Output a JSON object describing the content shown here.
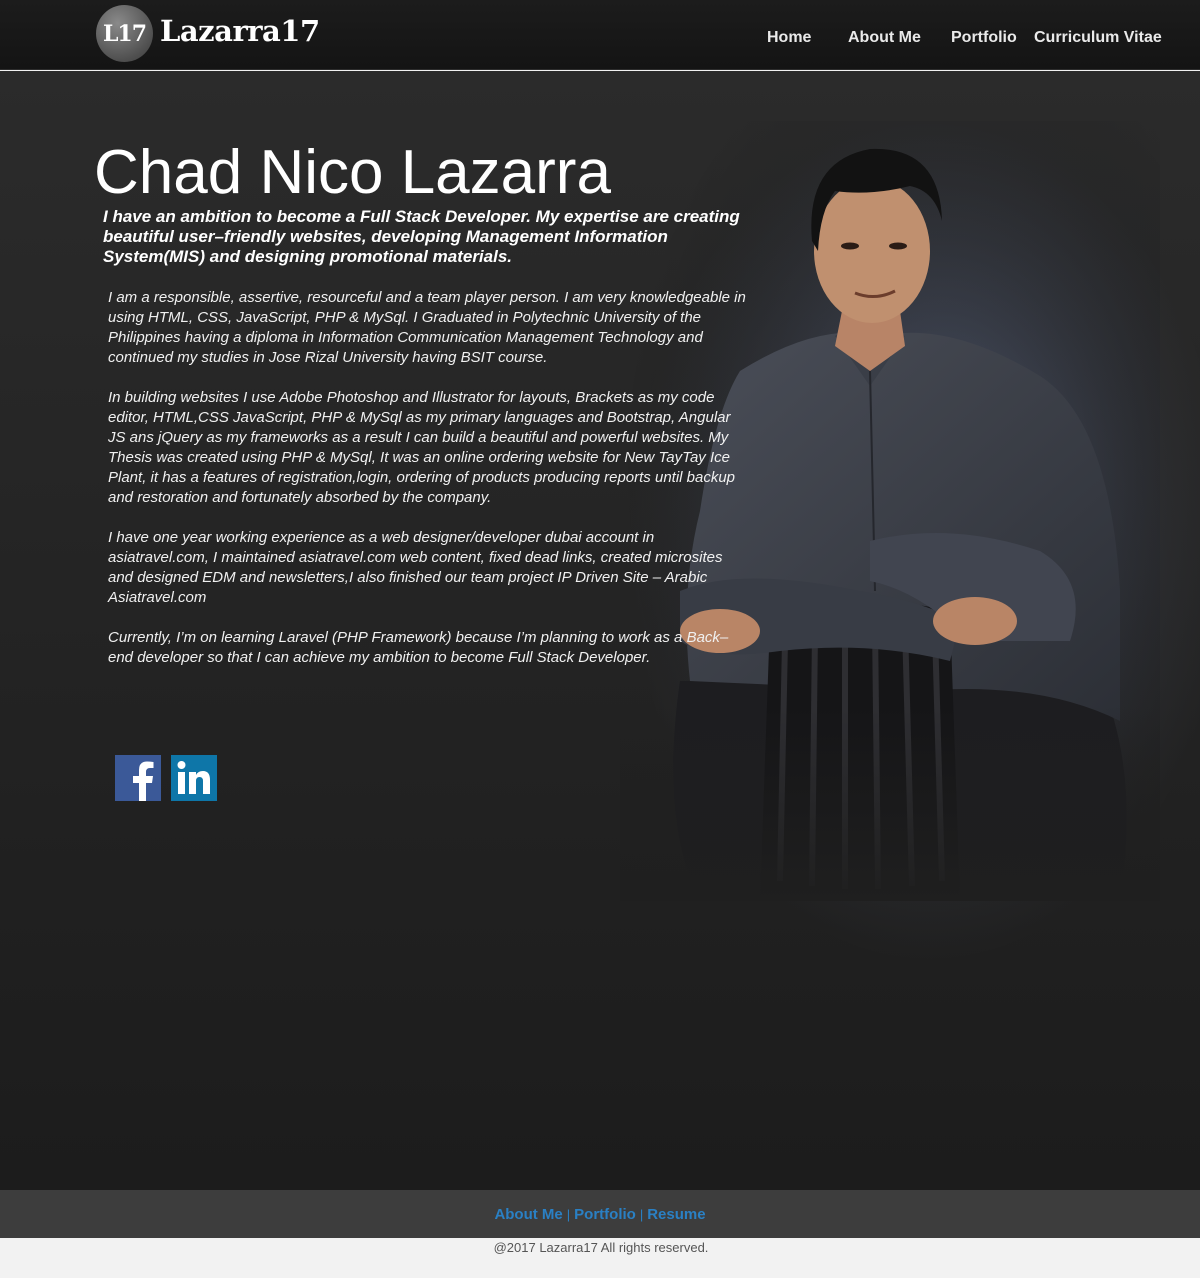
{
  "header": {
    "logo_badge": "L17",
    "logo_text": "Lazarra17",
    "nav": [
      {
        "label": "Home"
      },
      {
        "label": "About Me"
      },
      {
        "label": "Portfolio"
      },
      {
        "label": "Curriculum Vitae"
      }
    ]
  },
  "main": {
    "name": "Chad Nico Lazarra",
    "tagline": "I have an ambition to become a Full Stack Developer.  My expertise are creating beautiful user–friendly websites, developing Management Information System(MIS) and designing promotional materials.",
    "paragraphs": [
      "I am a responsible, assertive, resourceful and a team player person. I am very knowledgeable in using HTML, CSS, JavaScript, PHP & MySql.  I Graduated in Polytechnic University of the Philippines having a diploma in Information Communication Management Technology and continued my studies in Jose Rizal University having BSIT course.",
      "In building websites I use Adobe Photoshop and Illustrator for layouts, Brackets as my code editor, HTML,CSS JavaScript, PHP & MySql as my primary languages and Bootstrap, Angular JS ans jQuery as my frameworks as a result I can build a beautiful and powerful websites.  My Thesis was created using PHP & MySql, It was an online ordering website for New TayTay Ice Plant, it has a features of registration,login, ordering of products producing reports until backup and restoration and fortunately absorbed by the company.",
      "I have one year working experience as a web designer/developer dubai account in asiatravel.com, I maintained asiatravel.com web content, fixed dead links, created microsites and designed EDM and newsletters,I also finished our team project IP Driven Site – Arabic Asiatravel.com",
      "Currently, I’m on learning Laravel (PHP Framework) because I’m planning to work as a Back–end developer so that I can achieve my ambition to become Full Stack Developer."
    ],
    "social": [
      {
        "name": "facebook",
        "glyph": "f",
        "color": "#3b5998"
      },
      {
        "name": "linkedin",
        "glyph": "in",
        "color": "#0e76a8"
      }
    ]
  },
  "footer": {
    "links": [
      {
        "label": "About Me"
      },
      {
        "label": "Portfolio"
      },
      {
        "label": "Resume"
      }
    ],
    "separator": "|",
    "copyright": "@2017 Lazarra17 All rights  reserved."
  },
  "colors": {
    "header_bg": "#181818",
    "main_bg": "#262626",
    "footer_bar": "#3d3d3d",
    "footer_link": "#2a80c4",
    "copyright_bg": "#f2f2f2"
  }
}
